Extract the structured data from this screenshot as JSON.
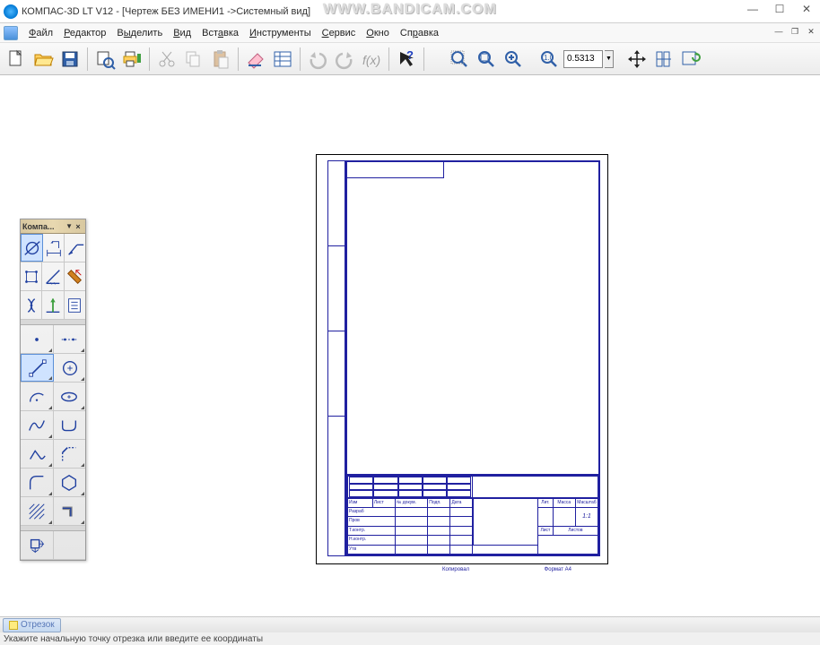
{
  "title": "КОМПАС-3D LT V12 - [Чертеж БЕЗ ИМЕНИ1 ->Системный вид]",
  "watermark": "WWW.BANDICAM.COM",
  "menu": {
    "file": "Файл",
    "edit": "Редактор",
    "select": "Выделить",
    "view": "Вид",
    "insert": "Вставка",
    "tools": "Инструменты",
    "service": "Сервис",
    "window": "Окно",
    "help": "Справка"
  },
  "zoom": {
    "value": "0.5313"
  },
  "toolpanel": {
    "title": "Компа..."
  },
  "taskbar": {
    "tab": "Отрезок"
  },
  "status": "Укажите начальную точку отрезка или введите ее координаты",
  "titleblock": {
    "r1": [
      "Изм",
      "Лист",
      "№ докум.",
      "Подп.",
      "Дата"
    ],
    "r2": "Разраб",
    "r3": "Пров",
    "r4": "Т.контр.",
    "r5": "Н.контр.",
    "r6": "Утв",
    "h": [
      "Лит.",
      "Масса",
      "Масштаб"
    ],
    "sheet": "Лист",
    "sheets": "Листов",
    "ratio": "1:1"
  },
  "footer": {
    "left": "Копировал",
    "right": "Формат   A4"
  }
}
